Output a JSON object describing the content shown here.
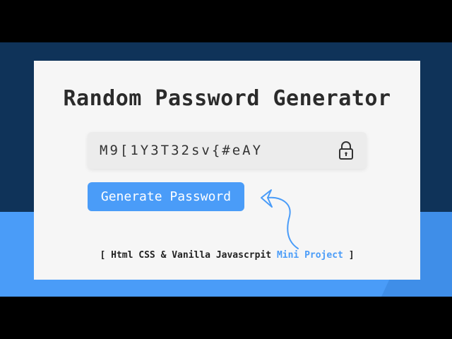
{
  "app": {
    "title": "Random Password Generator"
  },
  "password_field": {
    "value": "M9[1Y3T32sv{#eAY"
  },
  "buttons": {
    "generate_label": "Generate Password"
  },
  "footer": {
    "open_bracket": "[",
    "text": "Html CSS & Vanilla Javascrpit",
    "accent_text": "Mini Project",
    "close_bracket": "]"
  },
  "icons": {
    "lock": "lock-icon",
    "arrow": "hand-drawn-arrow-icon"
  },
  "colors": {
    "accent": "#4a9cf8",
    "dark_blue": "#0f3359",
    "card": "#f6f6f6",
    "title_text": "#2b2b2b"
  }
}
